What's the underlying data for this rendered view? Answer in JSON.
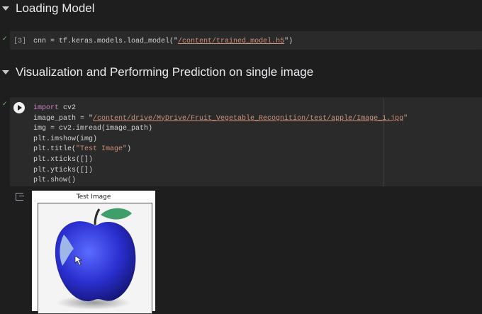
{
  "sections": [
    {
      "title": "Loading Model"
    },
    {
      "title": "Visualization and Performing Prediction on single image"
    }
  ],
  "cell1": {
    "exec_count": "[3]",
    "pre": "cnn = tf.keras.models.load_model(\"",
    "path": "/content/trained_model.h5",
    "post": "\")"
  },
  "cell2": {
    "line1_kw": "import",
    "line1_rest": " cv2",
    "line2_pre": "image_path = \"",
    "line2_path": "/content/drive/MyDrive/Fruit_Vegetable_Recognition/test/apple/Image_1.jpg",
    "line2_post": "\"",
    "line3": "img = cv2.imread(image_path)",
    "line4": "plt.imshow(img)",
    "line5_pre": "plt.title(",
    "line5_str": "\"Test Image\"",
    "line5_post": ")",
    "line6": "plt.xticks([])",
    "line7": "plt.yticks([])",
    "line8": "plt.show()"
  },
  "output": {
    "figure_title": "Test Image"
  },
  "icons": {
    "check": "check-icon",
    "run": "play-circle-icon",
    "output": "output-icon",
    "caret": "caret-down-icon"
  },
  "colors": {
    "background": "#1e1e1e",
    "cell": "#2a2a2a",
    "string": "#ce9178",
    "keyword": "#c586c0",
    "apple": "#2b2fd0"
  }
}
